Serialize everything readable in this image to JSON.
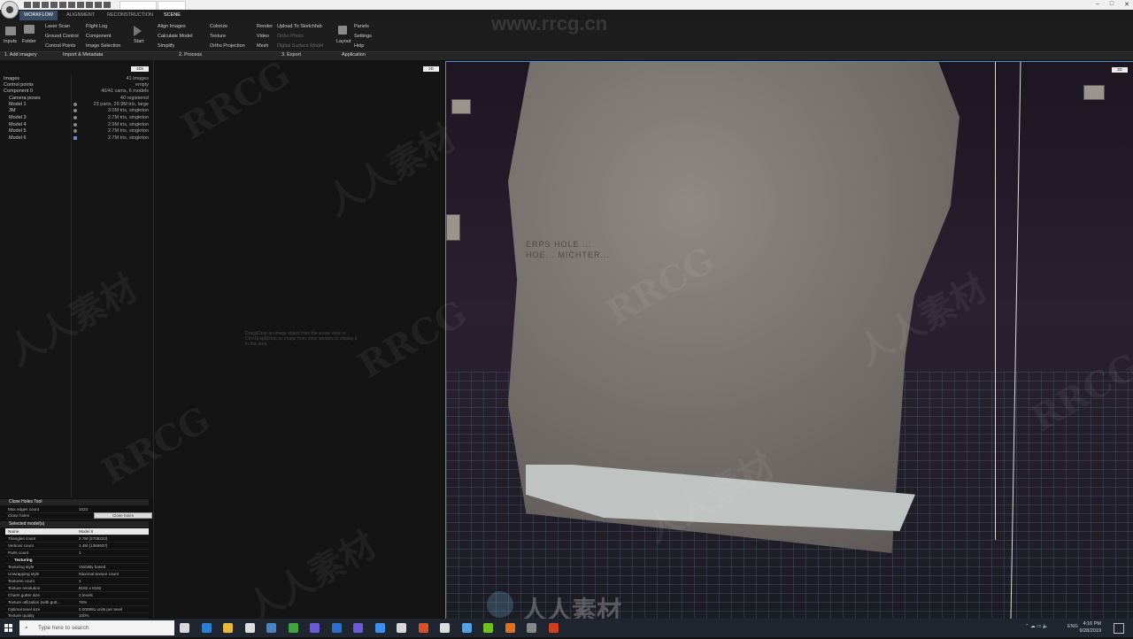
{
  "window": {
    "controls": [
      "–",
      "□",
      "✕"
    ]
  },
  "ribbon_tabs": [
    "WORKFLOW",
    "ALIGNMENT",
    "RECONSTRUCTION",
    "SCENE"
  ],
  "ribbon": {
    "inputs": "Inputs",
    "folder": "Folder",
    "col1": [
      "Laser Scan",
      "Ground Control",
      "Control Points"
    ],
    "col2": [
      "Flight Log",
      "Component",
      "Image Selection"
    ],
    "start": "Start",
    "col3": [
      "Align Images",
      "Calculate Model",
      "Simplify"
    ],
    "col4": [
      "Colorize",
      "Texture",
      "Ortho Projection"
    ],
    "col5": [
      "Render",
      "Video",
      "Mesh"
    ],
    "col6": [
      "Upload To Sketchfab",
      "Ortho Photo",
      "Digital Surface Model"
    ],
    "layout": "Layout",
    "col7": [
      "Panels",
      "Settings",
      "Help"
    ]
  },
  "sections": [
    "1. Add imagery",
    "Import & Metadata",
    "2. Process",
    "3. Export",
    "Application"
  ],
  "panel_buttons": [
    "1Ds",
    "2D",
    "3D"
  ],
  "tree": [
    {
      "name": "Images",
      "value": "41 images"
    },
    {
      "name": "Control points",
      "value": "empty"
    },
    {
      "name": "Component 0",
      "value": "40/41 cams, 6 models"
    },
    {
      "name": "Camera poses",
      "value": "40 registered"
    },
    {
      "name": "Model 1",
      "value": "23 parts, 29.9M tris, large"
    },
    {
      "name": "3M",
      "value": "3.0M tris, singleton"
    },
    {
      "name": "Model 3",
      "value": "2.7M tris, singleton"
    },
    {
      "name": "Model 4",
      "value": "2.9M tris, singleton"
    },
    {
      "name": "Model 5",
      "value": "2.7M tris, singleton"
    },
    {
      "name": "Model 6",
      "value": "2.7M tris, singleton"
    }
  ],
  "drag_hint": "Drag&Drop an image object from the scene view or Ctrl+Drag&Drop an image from other window to display it in this area.",
  "close_holes": {
    "title": "Close Holes Tool",
    "rows": [
      {
        "k": "Max edges count",
        "v": "1024"
      },
      {
        "k": "Close holes",
        "v": "Close holes"
      }
    ]
  },
  "selected": {
    "title": "Selected model(s)",
    "rows": [
      {
        "k": "Name",
        "v": "Model 6"
      },
      {
        "k": "Triangles count",
        "v": "2.7M (2708222)"
      },
      {
        "k": "Vertices count",
        "v": "1.4M (1369937)"
      },
      {
        "k": "Parts count",
        "v": "1"
      }
    ],
    "texturing_label": "Texturing",
    "tex_rows": [
      {
        "k": "Texturing style",
        "v": "Visibility based"
      },
      {
        "k": "Unwrapping style",
        "v": "Maximal texture count"
      },
      {
        "k": "Textures count",
        "v": "1"
      },
      {
        "k": "Texture resolution",
        "v": "8192 x 8192"
      },
      {
        "k": "Charts gutter size",
        "v": "2 texels"
      },
      {
        "k": "Texture utilization (with gutt...",
        "v": "76%"
      },
      {
        "k": "Optimal texel size",
        "v": "0.000891 units per texel"
      },
      {
        "k": "Texture quality",
        "v": "100%"
      }
    ]
  },
  "watermark": {
    "site": "www.rrcg.cn",
    "brand": "RRCG",
    "cn": "人人素材"
  },
  "rock_inscription": [
    "ERPS HOLE ...",
    "HOE... MICHTER..."
  ],
  "taskbar": {
    "search_placeholder": "Type here to search",
    "lang": "ENG",
    "time": "4:16 PM",
    "date": "9/28/2019",
    "icon_colors": [
      "#d8d8d8",
      "#2d7fd2",
      "#e8b73e",
      "#ddd",
      "#4a84c8",
      "#3fa63f",
      "#6a5ad6",
      "#2a6ecf",
      "#6a5ad6",
      "#3e8ef0",
      "#d8d8d8",
      "#d94e2b",
      "#ddd",
      "#55a0e0",
      "#70c020",
      "#e07020",
      "#888",
      "#d04020"
    ]
  }
}
